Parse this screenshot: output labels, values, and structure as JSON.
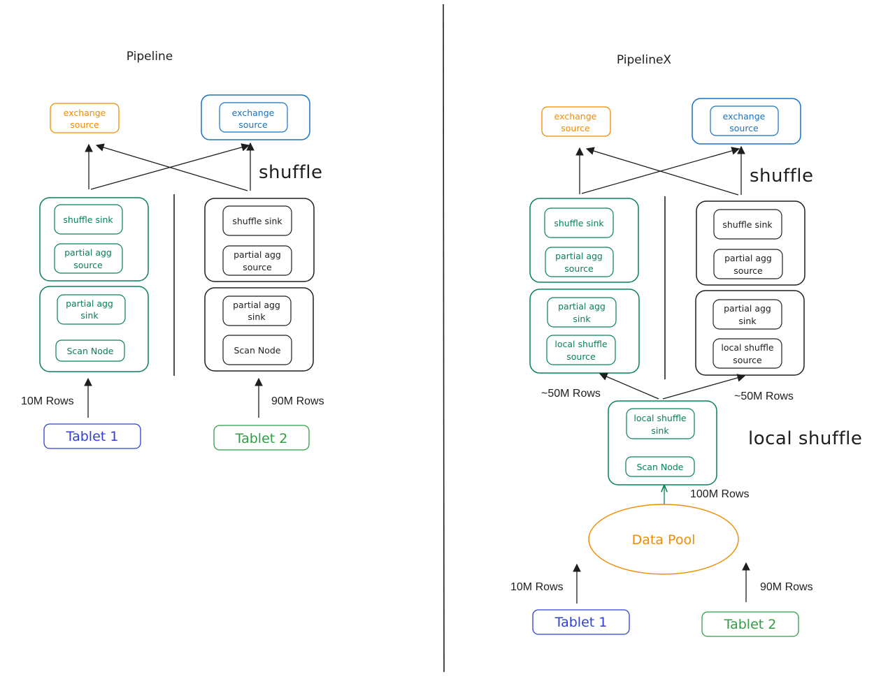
{
  "colors": {
    "ink": "#1e1e1e",
    "orange": "#f08c00",
    "blue": "#1971c2",
    "green": "#087f5b",
    "tablet_blue": "#2f3fd8",
    "tablet_green": "#2f9e44"
  },
  "left": {
    "title": "Pipeline",
    "shuffle_label": "shuffle",
    "exchange_left": {
      "line1": "exchange",
      "line2": "source"
    },
    "exchange_right": {
      "line1": "exchange",
      "line2": "source"
    },
    "col1": {
      "upper": [
        {
          "line1": "shuffle sink",
          "line2": ""
        },
        {
          "line1": "partial agg",
          "line2": "source"
        }
      ],
      "lower": [
        {
          "line1": "partial agg",
          "line2": "sink"
        },
        {
          "line1": "Scan Node",
          "line2": ""
        }
      ]
    },
    "col2": {
      "upper": [
        {
          "line1": "shuffle sink",
          "line2": ""
        },
        {
          "line1": "partial agg",
          "line2": "source"
        }
      ],
      "lower": [
        {
          "line1": "partial agg",
          "line2": "sink"
        },
        {
          "line1": "Scan Node",
          "line2": ""
        }
      ]
    },
    "rows_left": "10M Rows",
    "rows_right": "90M Rows",
    "tablet1": "Tablet 1",
    "tablet2": "Tablet 2"
  },
  "right": {
    "title": "PipelineX",
    "shuffle_label": "shuffle",
    "local_shuffle_label": "local shuffle",
    "exchange_left": {
      "line1": "exchange",
      "line2": "source"
    },
    "exchange_right": {
      "line1": "exchange",
      "line2": "source"
    },
    "col1": {
      "upper": [
        {
          "line1": "shuffle sink",
          "line2": ""
        },
        {
          "line1": "partial agg",
          "line2": "source"
        }
      ],
      "lower": [
        {
          "line1": "partial agg",
          "line2": "sink"
        },
        {
          "line1": "local shuffle",
          "line2": "source"
        }
      ]
    },
    "col2": {
      "upper": [
        {
          "line1": "shuffle sink",
          "line2": ""
        },
        {
          "line1": "partial agg",
          "line2": "source"
        }
      ],
      "lower": [
        {
          "line1": "partial agg",
          "line2": "sink"
        },
        {
          "line1": "local shuffle",
          "line2": "source"
        }
      ]
    },
    "local_box": [
      {
        "line1": "local shuffle",
        "line2": "sink"
      },
      {
        "line1": "Scan Node",
        "line2": ""
      }
    ],
    "rows_split_left": "~50M Rows",
    "rows_split_right": "~50M Rows",
    "rows_total": "100M Rows",
    "data_pool": "Data Pool",
    "rows_left": "10M Rows",
    "rows_right": "90M Rows",
    "tablet1": "Tablet 1",
    "tablet2": "Tablet 2"
  }
}
